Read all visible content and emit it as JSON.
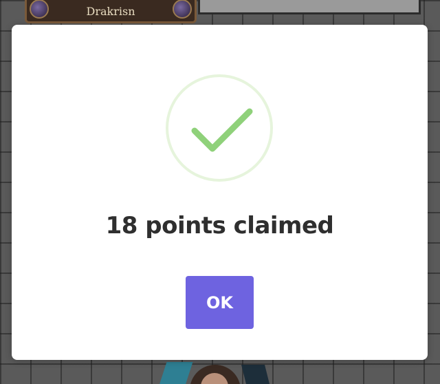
{
  "background": {
    "character_name": "Drakrisn"
  },
  "dialog": {
    "icon": "checkmark-icon",
    "message": "18 points claimed",
    "ok_label": "OK"
  },
  "colors": {
    "accent": "#6e63e0",
    "success": "#8fd17a",
    "success_ring": "#e6f4dc",
    "text": "#2f2f2f"
  }
}
